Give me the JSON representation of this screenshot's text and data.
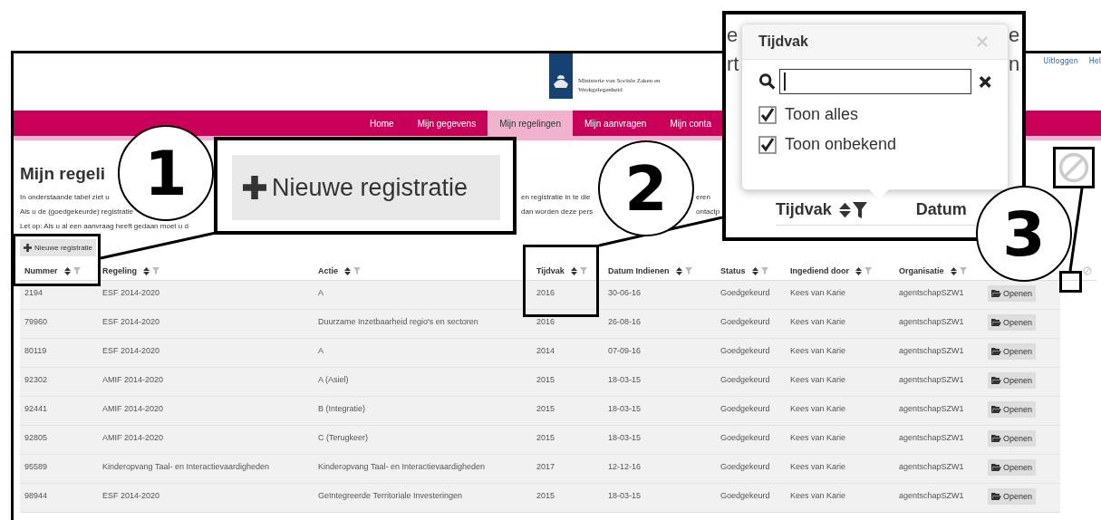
{
  "header": {
    "ministry": "Ministerie van Sociale Zaken en Werkgelegenheid",
    "links": [
      {
        "label": "Uitloggen"
      },
      {
        "label": "Hel"
      }
    ]
  },
  "nav": [
    {
      "label": "Home",
      "selected": false
    },
    {
      "label": "Mijn gegevens",
      "selected": false
    },
    {
      "label": "Mijn regelingen",
      "selected": true
    },
    {
      "label": "Mijn aanvragen",
      "selected": false
    },
    {
      "label": "Mijn conta",
      "selected": false
    }
  ],
  "title": "Mijn regeli",
  "intro": [
    [
      "In onderstaande tabel ziet u",
      "en registratie in te die",
      "eren"
    ],
    [
      "Als u de (goedgekeurde) registratie",
      "dan worden deze pers",
      "ontactp"
    ],
    [
      "Let op: Als u al een aanvraag heeft gedaan moet u d"
    ]
  ],
  "new_button": {
    "label": "Nieuwe registratie"
  },
  "table": {
    "columns": [
      "Nummer",
      "Regeling",
      "Actie",
      "Tijdvak",
      "Datum Indienen",
      "Status",
      "Ingediend door",
      "Organisatie"
    ],
    "rows": [
      {
        "cells": [
          "2194",
          "ESF 2014-2020",
          "A",
          "2016",
          "30-06-16",
          "Goedgekeurd",
          "Kees van Karie",
          "agentschapSZW1"
        ],
        "action": "Openen"
      },
      {
        "cells": [
          "79960",
          "ESF 2014-2020",
          "Duurzame Inzetbaarheid regio's en sectoren",
          "2016",
          "26-08-16",
          "Goedgekeurd",
          "Kees van Karie",
          "agentschapSZW1"
        ],
        "action": "Openen"
      },
      {
        "cells": [
          "80119",
          "ESF 2014-2020",
          "A",
          "2014",
          "07-09-16",
          "Goedgekeurd",
          "Kees van Karie",
          "agentschapSZW1"
        ],
        "action": "Openen"
      },
      {
        "cells": [
          "92302",
          "AMIF 2014-2020",
          "A (Asiel)",
          "2015",
          "18-03-15",
          "Goedgekeurd",
          "Kees van Karie",
          "agentschapSZW1"
        ],
        "action": "Openen"
      },
      {
        "cells": [
          "92441",
          "AMIF 2014-2020",
          "B (Integratie)",
          "2015",
          "18-03-15",
          "Goedgekeurd",
          "Kees van Karie",
          "agentschapSZW1"
        ],
        "action": "Openen"
      },
      {
        "cells": [
          "92805",
          "AMIF 2014-2020",
          "C (Terugkeer)",
          "2015",
          "18-03-15",
          "Goedgekeurd",
          "Kees van Karie",
          "agentschapSZW1"
        ],
        "action": "Openen"
      },
      {
        "cells": [
          "95589",
          "Kinderopvang Taal- en Interactievaardigheden",
          "Kinderopvang Taal- en Interactievaardigheden",
          "2017",
          "12-12-16",
          "Goedgekeurd",
          "Kees van Karie",
          "agentschapSZW1"
        ],
        "action": "Openen"
      },
      {
        "cells": [
          "98944",
          "ESF 2014-2020",
          "Geïntegreerde Territoriale Investeringen",
          "2015",
          "18-03-15",
          "Goedgekeurd",
          "Kees van Karie",
          "agentschapSZW1"
        ],
        "action": "Openen"
      }
    ]
  },
  "annotations": {
    "callouts": [
      "1",
      "2",
      "3"
    ],
    "zoom_button": {
      "label": "Nieuwe registratie"
    },
    "zoom_fragments": [
      "e",
      "rt",
      "e",
      "n"
    ],
    "popover": {
      "title": "Tijdvak",
      "options": [
        {
          "label": "Toon alles",
          "checked": true
        },
        {
          "label": "Toon onbekend",
          "checked": true
        }
      ],
      "column_label": "Tijdvak",
      "next_column_label": "Datum"
    }
  }
}
